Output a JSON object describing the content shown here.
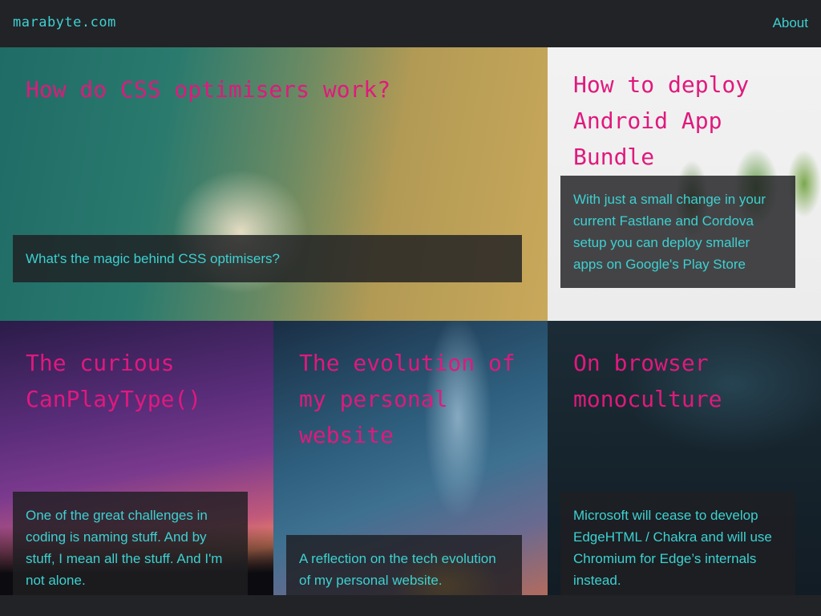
{
  "header": {
    "site_name": "marabyte.com",
    "nav_about": "About"
  },
  "posts": [
    {
      "title": "How do CSS optimisers work?",
      "excerpt": "What's the magic behind CSS optimisers?"
    },
    {
      "title": "How to deploy Android App Bundle",
      "excerpt": "With just a small change in your current Fastlane and Cordova setup you can deploy smaller apps on Google's Play Store"
    },
    {
      "title": "The curious CanPlayType()",
      "excerpt": "One of the great challenges in coding is naming stuff. And by stuff, I mean all the stuff. And I'm not alone."
    },
    {
      "title": "The evolution of my personal website",
      "excerpt": "A reflection on the tech evolution of my personal website."
    },
    {
      "title": "On browser monoculture",
      "excerpt": "Microsoft will cease to develop EdgeHTML / Chakra and will use Chromium for Edge’s internals instead."
    }
  ],
  "colors": {
    "accent_cyan": "#3dd1d1",
    "title_pink": "#e0197d",
    "background": "#222327"
  }
}
